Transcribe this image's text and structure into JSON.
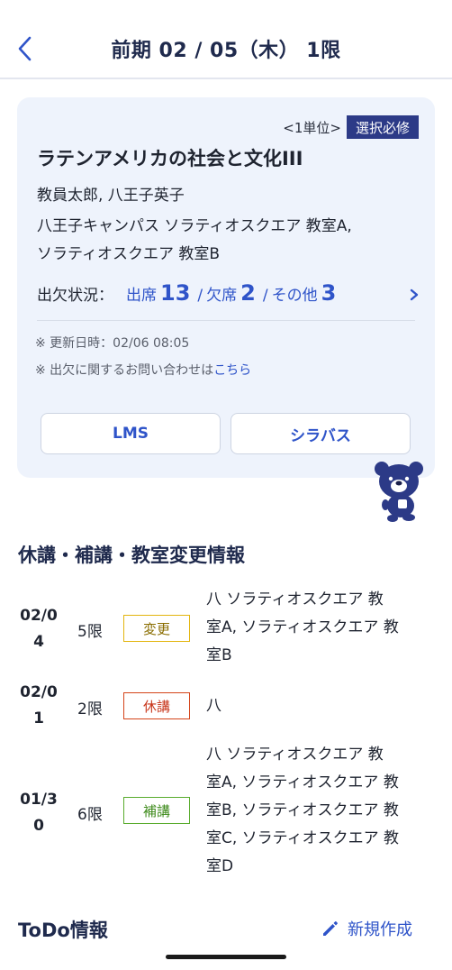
{
  "header": {
    "title": "前期 02 / 05（木） 1限",
    "back_icon": "chevron-left-icon"
  },
  "course": {
    "unit_text": "<1単位>",
    "required_badge": "選択必修",
    "title": "ラテンアメリカの社会と文化III",
    "teachers": "教員太郎, 八王子英子",
    "location_line1": "八王子キャンパス ソラティオスクエア 教室A,",
    "location_line2": "ソラティオスクエア 教室B",
    "attendance": {
      "label": "出欠状況：",
      "present_label": "出席",
      "present_count": "13",
      "absent_label": "欠席",
      "absent_count": "2",
      "other_label": "その他",
      "other_count": "3",
      "separator": "/"
    },
    "updated_note": "※ 更新日時：02/06 08:05",
    "inquiry_prefix": "※ 出欠に関するお問い合わせは",
    "inquiry_link": "こちら",
    "lms_button": "LMS",
    "syllabus_button": "シラバス"
  },
  "changes": {
    "title": "休講・補講・教室変更情報",
    "rows": [
      {
        "date_line1": "02/0",
        "date_line2": "4",
        "period": "5限",
        "badge": "変更",
        "room_line1": "八 ソラティオスクエア 教",
        "room_line2": "室A, ソラティオスクエア 教",
        "room_line3": "室B"
      },
      {
        "date_line1": "02/0",
        "date_line2": "1",
        "period": "2限",
        "badge": "休講",
        "room_line1": "八"
      },
      {
        "date_line1": "01/3",
        "date_line2": "0",
        "period": "6限",
        "badge": "補講",
        "room_line1": "八 ソラティオスクエア 教",
        "room_line2": "室A, ソラティオスクエア 教",
        "room_line3": "室B, ソラティオスクエア 教",
        "room_line4": "室C, ソラティオスクエア 教",
        "room_line5": "室D"
      }
    ]
  },
  "todo": {
    "title": "ToDo情報",
    "new_button": "新規作成",
    "new_icon": "pencil-icon"
  },
  "colors": {
    "accent": "#2f54c9",
    "navy": "#2c3a87",
    "card_bg": "#eef3fc",
    "change": "#e3b50e",
    "cancel": "#d44419",
    "makeup": "#58ab2c"
  }
}
